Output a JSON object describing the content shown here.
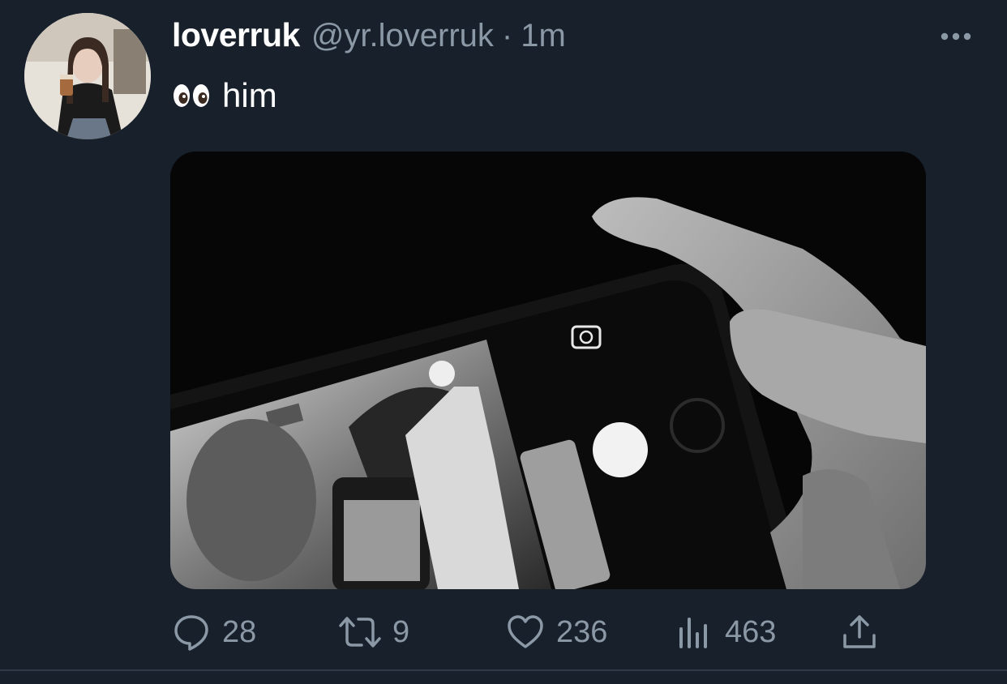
{
  "tweet": {
    "display_name": "loverruk",
    "handle": "@yr.loverruk",
    "separator": "·",
    "time": "1m",
    "text": "him",
    "text_emoji": "eyes-emoji"
  },
  "actions": {
    "reply_count": "28",
    "retweet_count": "9",
    "like_count": "236",
    "views_count": "463"
  },
  "icons": {
    "more": "more-horizontal-icon",
    "reply": "reply-icon",
    "retweet": "retweet-icon",
    "like": "heart-icon",
    "views": "views-icon",
    "share": "share-icon"
  },
  "colors": {
    "background": "#17202b",
    "primary_text": "#ffffff",
    "secondary_text": "#8b98a5",
    "divider": "#2f3a46"
  }
}
